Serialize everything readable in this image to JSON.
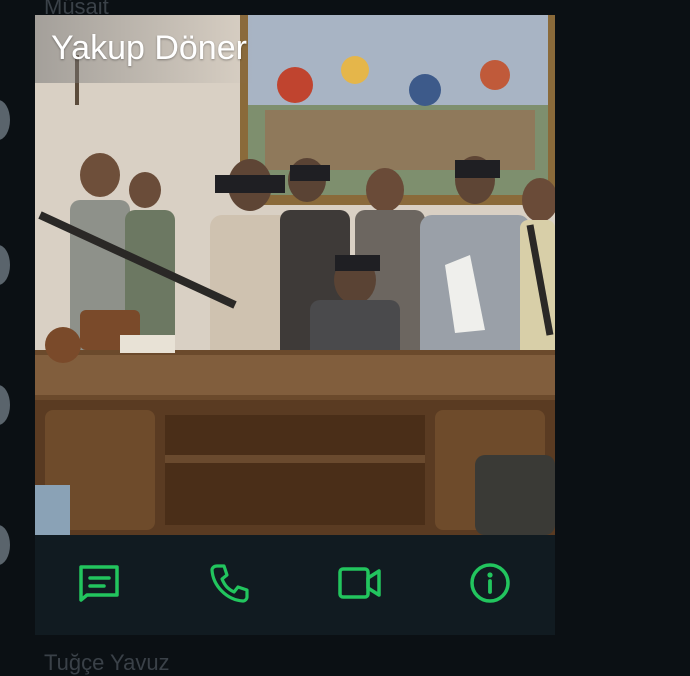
{
  "background": {
    "top_text": "Müsait",
    "bottom_text": "Tuğçe Yavuz"
  },
  "contact_card": {
    "name": "Yakup Döner",
    "photo_description_icon": "contact-profile-photo"
  },
  "actions": [
    {
      "name": "message",
      "icon": "message-icon"
    },
    {
      "name": "call",
      "icon": "phone-icon"
    },
    {
      "name": "video",
      "icon": "video-camera-icon"
    },
    {
      "name": "info",
      "icon": "info-icon"
    }
  ],
  "colors": {
    "accent": "#22c55e",
    "card_background": "#111b21",
    "page_background": "#0b1014"
  }
}
